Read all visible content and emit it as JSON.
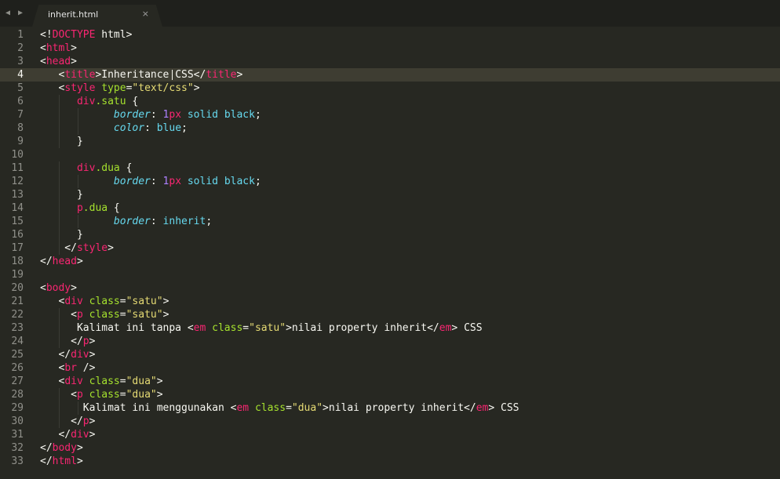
{
  "window": {
    "tab_title": "inherit.html",
    "tab_close_glyph": "×",
    "nav_back_glyph": "◀",
    "nav_forward_glyph": "▶"
  },
  "theme": {
    "background": "#272822",
    "tag": "#f92672",
    "attribute": "#a6e22e",
    "string": "#e6db74",
    "property": "#66d9ef",
    "number": "#ae81ff"
  },
  "editor": {
    "active_line": 4,
    "lines": [
      {
        "n": "1",
        "tokens": [
          [
            "plain",
            "<!"
          ],
          [
            "tag",
            "DOCTYPE"
          ],
          [
            "plain",
            " html>"
          ]
        ]
      },
      {
        "n": "2",
        "tokens": [
          [
            "plain",
            "<"
          ],
          [
            "tag",
            "html"
          ],
          [
            "plain",
            ">"
          ]
        ]
      },
      {
        "n": "3",
        "tokens": [
          [
            "plain",
            "<"
          ],
          [
            "tag",
            "head"
          ],
          [
            "plain",
            ">"
          ]
        ]
      },
      {
        "n": "4",
        "tokens": [
          [
            "plain",
            "   <"
          ],
          [
            "tag",
            "title"
          ],
          [
            "plain",
            ">Inheritance CSS</"
          ],
          [
            "tag",
            "title"
          ],
          [
            "plain",
            ">"
          ]
        ]
      },
      {
        "n": "5",
        "tokens": [
          [
            "plain",
            "   <"
          ],
          [
            "tag",
            "style"
          ],
          [
            "plain",
            " "
          ],
          [
            "attr",
            "type"
          ],
          [
            "plain",
            "="
          ],
          [
            "str",
            "\"text/css\""
          ],
          [
            "plain",
            ">"
          ]
        ]
      },
      {
        "n": "6",
        "tokens": [
          [
            "plain",
            "      "
          ],
          [
            "sel",
            "div"
          ],
          [
            "cls",
            ".satu"
          ],
          [
            "plain",
            " {"
          ]
        ]
      },
      {
        "n": "7",
        "tokens": [
          [
            "plain",
            "            "
          ],
          [
            "prop",
            "border"
          ],
          [
            "plain",
            ": "
          ],
          [
            "num",
            "1"
          ],
          [
            "unit",
            "px"
          ],
          [
            "plain",
            " "
          ],
          [
            "val",
            "solid"
          ],
          [
            "plain",
            " "
          ],
          [
            "val",
            "black"
          ],
          [
            "plain",
            ";"
          ]
        ]
      },
      {
        "n": "8",
        "tokens": [
          [
            "plain",
            "            "
          ],
          [
            "prop",
            "color"
          ],
          [
            "plain",
            ": "
          ],
          [
            "val",
            "blue"
          ],
          [
            "plain",
            ";"
          ]
        ]
      },
      {
        "n": "9",
        "tokens": [
          [
            "plain",
            "      }"
          ]
        ]
      },
      {
        "n": "10",
        "tokens": []
      },
      {
        "n": "11",
        "tokens": [
          [
            "plain",
            "      "
          ],
          [
            "sel",
            "div"
          ],
          [
            "cls",
            ".dua"
          ],
          [
            "plain",
            " {"
          ]
        ]
      },
      {
        "n": "12",
        "tokens": [
          [
            "plain",
            "            "
          ],
          [
            "prop",
            "border"
          ],
          [
            "plain",
            ": "
          ],
          [
            "num",
            "1"
          ],
          [
            "unit",
            "px"
          ],
          [
            "plain",
            " "
          ],
          [
            "val",
            "solid"
          ],
          [
            "plain",
            " "
          ],
          [
            "val",
            "black"
          ],
          [
            "plain",
            ";"
          ]
        ]
      },
      {
        "n": "13",
        "tokens": [
          [
            "plain",
            "      }"
          ]
        ]
      },
      {
        "n": "14",
        "tokens": [
          [
            "plain",
            "      "
          ],
          [
            "sel",
            "p"
          ],
          [
            "cls",
            ".dua"
          ],
          [
            "plain",
            " {"
          ]
        ]
      },
      {
        "n": "15",
        "tokens": [
          [
            "plain",
            "            "
          ],
          [
            "prop",
            "border"
          ],
          [
            "plain",
            ": "
          ],
          [
            "val",
            "inherit"
          ],
          [
            "plain",
            ";"
          ]
        ]
      },
      {
        "n": "16",
        "tokens": [
          [
            "plain",
            "      }"
          ]
        ]
      },
      {
        "n": "17",
        "tokens": [
          [
            "plain",
            "    </"
          ],
          [
            "tag",
            "style"
          ],
          [
            "plain",
            ">"
          ]
        ]
      },
      {
        "n": "18",
        "tokens": [
          [
            "plain",
            "</"
          ],
          [
            "tag",
            "head"
          ],
          [
            "plain",
            ">"
          ]
        ]
      },
      {
        "n": "19",
        "tokens": []
      },
      {
        "n": "20",
        "tokens": [
          [
            "plain",
            "<"
          ],
          [
            "tag",
            "body"
          ],
          [
            "plain",
            ">"
          ]
        ]
      },
      {
        "n": "21",
        "tokens": [
          [
            "plain",
            "   <"
          ],
          [
            "tag",
            "div"
          ],
          [
            "plain",
            " "
          ],
          [
            "attr",
            "class"
          ],
          [
            "plain",
            "="
          ],
          [
            "str",
            "\"satu\""
          ],
          [
            "plain",
            ">"
          ]
        ]
      },
      {
        "n": "22",
        "tokens": [
          [
            "plain",
            "     <"
          ],
          [
            "tag",
            "p"
          ],
          [
            "plain",
            " "
          ],
          [
            "attr",
            "class"
          ],
          [
            "plain",
            "="
          ],
          [
            "str",
            "\"satu\""
          ],
          [
            "plain",
            ">"
          ]
        ]
      },
      {
        "n": "23",
        "tokens": [
          [
            "plain",
            "      Kalimat ini tanpa <"
          ],
          [
            "tag",
            "em"
          ],
          [
            "plain",
            " "
          ],
          [
            "attr",
            "class"
          ],
          [
            "plain",
            "="
          ],
          [
            "str",
            "\"satu\""
          ],
          [
            "plain",
            ">nilai property inherit</"
          ],
          [
            "tag",
            "em"
          ],
          [
            "plain",
            "> CSS"
          ]
        ]
      },
      {
        "n": "24",
        "tokens": [
          [
            "plain",
            "     </"
          ],
          [
            "tag",
            "p"
          ],
          [
            "plain",
            ">"
          ]
        ]
      },
      {
        "n": "25",
        "tokens": [
          [
            "plain",
            "   </"
          ],
          [
            "tag",
            "div"
          ],
          [
            "plain",
            ">"
          ]
        ]
      },
      {
        "n": "26",
        "tokens": [
          [
            "plain",
            "   <"
          ],
          [
            "tag",
            "br"
          ],
          [
            "plain",
            " />"
          ]
        ]
      },
      {
        "n": "27",
        "tokens": [
          [
            "plain",
            "   <"
          ],
          [
            "tag",
            "div"
          ],
          [
            "plain",
            " "
          ],
          [
            "attr",
            "class"
          ],
          [
            "plain",
            "="
          ],
          [
            "str",
            "\"dua\""
          ],
          [
            "plain",
            ">"
          ]
        ]
      },
      {
        "n": "28",
        "tokens": [
          [
            "plain",
            "     <"
          ],
          [
            "tag",
            "p"
          ],
          [
            "plain",
            " "
          ],
          [
            "attr",
            "class"
          ],
          [
            "plain",
            "="
          ],
          [
            "str",
            "\"dua\""
          ],
          [
            "plain",
            ">"
          ]
        ]
      },
      {
        "n": "29",
        "tokens": [
          [
            "plain",
            "       Kalimat ini menggunakan <"
          ],
          [
            "tag",
            "em"
          ],
          [
            "plain",
            " "
          ],
          [
            "attr",
            "class"
          ],
          [
            "plain",
            "="
          ],
          [
            "str",
            "\"dua\""
          ],
          [
            "plain",
            ">nilai property inherit</"
          ],
          [
            "tag",
            "em"
          ],
          [
            "plain",
            "> CSS"
          ]
        ]
      },
      {
        "n": "30",
        "tokens": [
          [
            "plain",
            "     </"
          ],
          [
            "tag",
            "p"
          ],
          [
            "plain",
            ">"
          ]
        ]
      },
      {
        "n": "31",
        "tokens": [
          [
            "plain",
            "   </"
          ],
          [
            "tag",
            "div"
          ],
          [
            "plain",
            ">"
          ]
        ]
      },
      {
        "n": "32",
        "tokens": [
          [
            "plain",
            "</"
          ],
          [
            "tag",
            "body"
          ],
          [
            "plain",
            ">"
          ]
        ]
      },
      {
        "n": "33",
        "tokens": [
          [
            "plain",
            "</"
          ],
          [
            "tag",
            "html"
          ],
          [
            "plain",
            ">"
          ]
        ]
      }
    ]
  }
}
